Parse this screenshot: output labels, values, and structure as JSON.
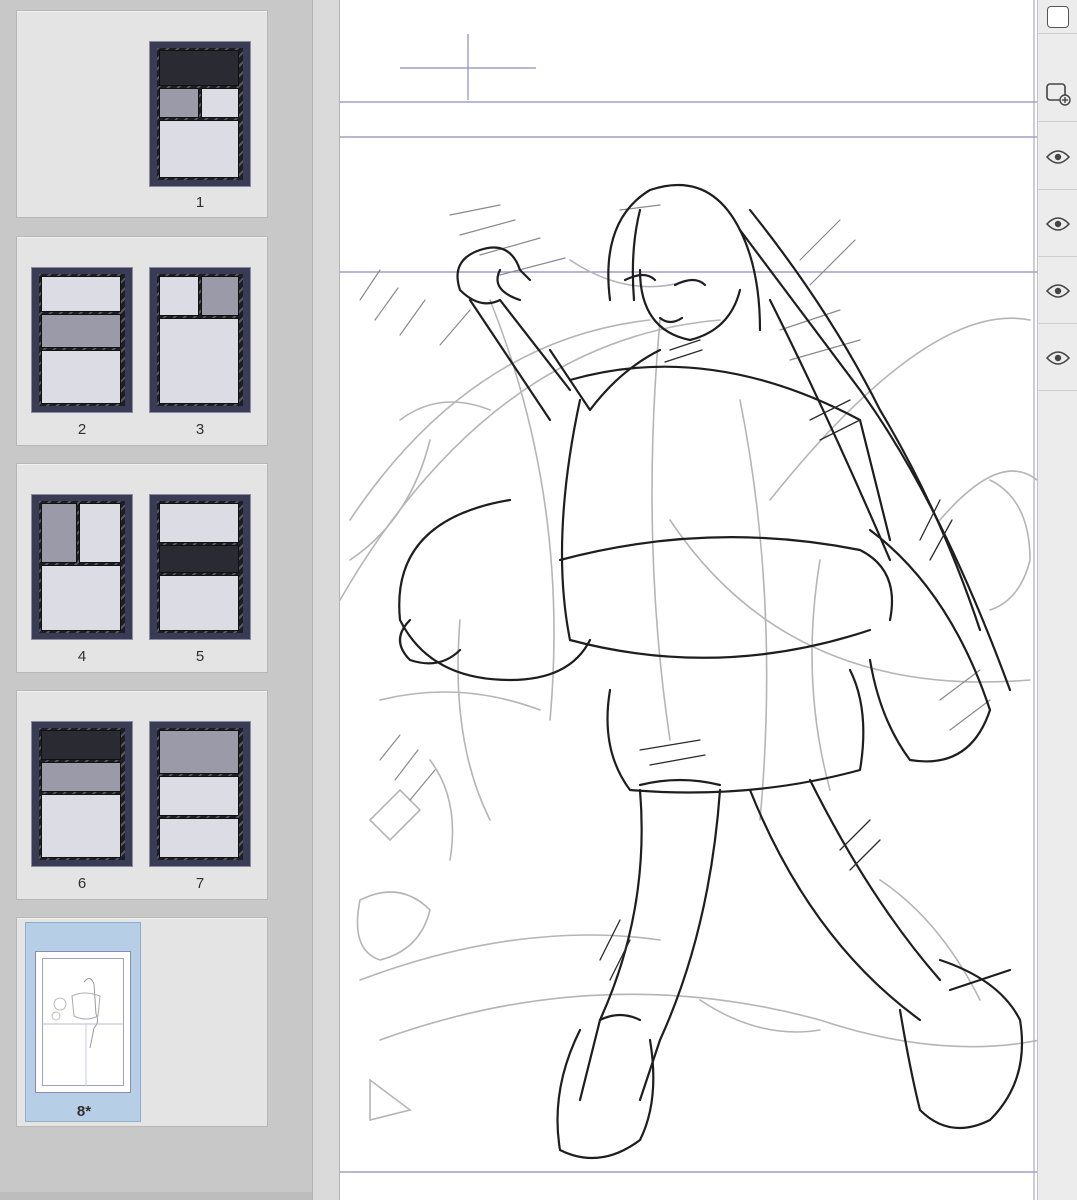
{
  "page_list": {
    "spreads": [
      {
        "pages": [
          {
            "number": "1"
          }
        ]
      },
      {
        "pages": [
          {
            "number": "2"
          },
          {
            "number": "3"
          }
        ]
      },
      {
        "pages": [
          {
            "number": "4"
          },
          {
            "number": "5"
          }
        ]
      },
      {
        "pages": [
          {
            "number": "6"
          },
          {
            "number": "7"
          }
        ]
      },
      {
        "pages": [
          {
            "number": "8*",
            "selected": true,
            "unsaved": true
          }
        ]
      }
    ]
  },
  "canvas": {
    "content": "pencil-sketch-drawing",
    "rulers": [
      "horizontal-guides",
      "crosshair-marker"
    ]
  },
  "layer_strip": {
    "buttons": [
      {
        "icon": "layer-square-icon"
      },
      {
        "icon": "new-layer-icon"
      },
      {
        "icon": "eye-icon"
      },
      {
        "icon": "eye-icon"
      },
      {
        "icon": "eye-icon"
      },
      {
        "icon": "eye-icon"
      }
    ]
  },
  "colors": {
    "panel_bg": "#c8c8c8",
    "selected_page": "#b7cfe6",
    "guide_line": "#8c8cc0",
    "thumb_frame": "#3a3b55"
  }
}
